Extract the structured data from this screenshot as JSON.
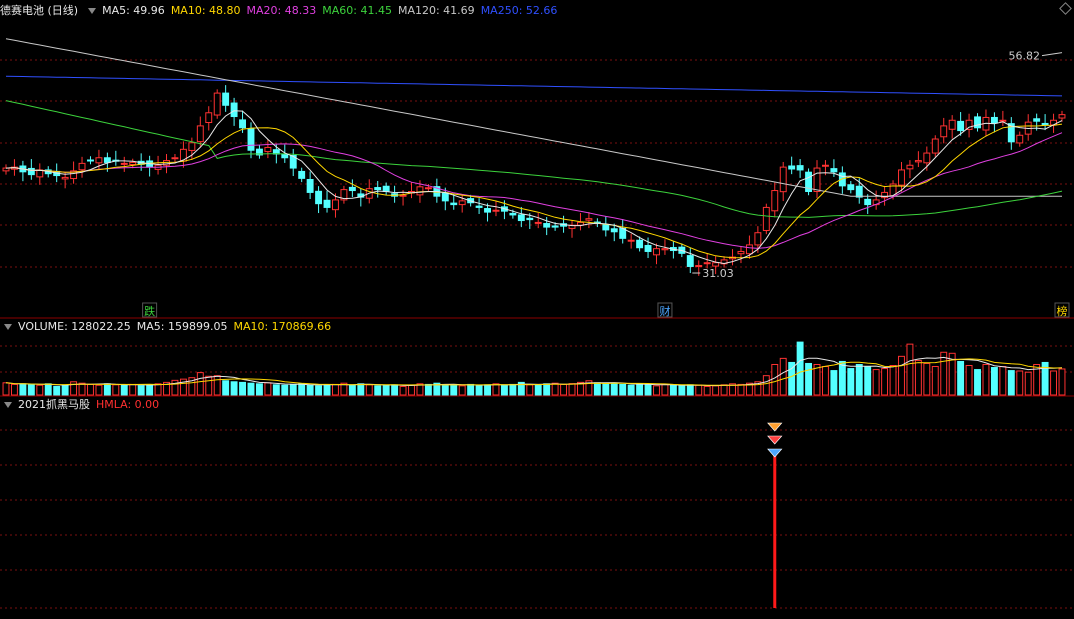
{
  "main": {
    "title": "德赛电池 (日线)",
    "ma_labels": [
      {
        "text": "MA5: 49.96",
        "color": "#e8e8e8"
      },
      {
        "text": "MA10: 48.80",
        "color": "#ffd700"
      },
      {
        "text": "MA20: 48.33",
        "color": "#e040e0"
      },
      {
        "text": "MA60: 41.45",
        "color": "#3cd23c"
      },
      {
        "text": "MA120: 41.69",
        "color": "#c8c8c8"
      },
      {
        "text": "MA250: 52.66",
        "color": "#3050ff"
      }
    ],
    "high_label": "56.82",
    "low_label": "31.03",
    "markers": [
      {
        "text": "跌",
        "color": "#3cd23c"
      },
      {
        "text": "财",
        "color": "#4da6ff"
      },
      {
        "text": "榜",
        "color": "#ffd700"
      }
    ]
  },
  "volume": {
    "labels": [
      {
        "text": "VOLUME: 128022.25",
        "color": "#e8e8e8"
      },
      {
        "text": "MA5: 159899.05",
        "color": "#e8e8e8"
      },
      {
        "text": "MA10: 170869.66",
        "color": "#ffd700"
      }
    ]
  },
  "indicator": {
    "labels": [
      {
        "text": "2021抓黑马股",
        "color": "#e8e8e8"
      },
      {
        "text": "HMLA: 0.00",
        "color": "#ff3030"
      }
    ]
  },
  "colors": {
    "up": "#ff3232",
    "down": "#54ffff",
    "grid": "#7a1010",
    "separator": "#8b0000"
  },
  "chart_data": {
    "type": "candlestick",
    "price_range": [
      28.8,
      60.6
    ],
    "ohlc_close": [
      44.8,
      44.9,
      44.4,
      44.1,
      44.6,
      44.2,
      44.0,
      43.8,
      44.5,
      45.3,
      45.6,
      45.9,
      45.4,
      45.6,
      45.3,
      45.4,
      45.2,
      44.9,
      45.1,
      45.6,
      45.9,
      46.8,
      47.5,
      49.3,
      50.7,
      52.8,
      51.5,
      50.3,
      49.1,
      46.7,
      46.2,
      47.0,
      46.3,
      45.9,
      44.8,
      43.7,
      42.2,
      41.0,
      40.6,
      41.4,
      42.5,
      42.4,
      41.7,
      42.6,
      42.5,
      42.3,
      41.8,
      41.9,
      42.3,
      42.8,
      42.7,
      41.8,
      41.3,
      40.9,
      41.3,
      41.1,
      40.6,
      40.1,
      40.3,
      40.2,
      39.8,
      39.2,
      39.3,
      39.0,
      38.5,
      38.5,
      38.6,
      38.7,
      39.0,
      39.4,
      38.9,
      38.2,
      38.0,
      37.3,
      37.1,
      36.3,
      35.9,
      36.2,
      36.2,
      36.0,
      35.7,
      34.3,
      34.4,
      34.7,
      34.7,
      35.0,
      35.3,
      35.9,
      36.6,
      37.9,
      40.6,
      42.4,
      44.9,
      44.7,
      44.6,
      42.3,
      44.8,
      45.1,
      44.4,
      42.9,
      42.5,
      41.7,
      40.9,
      41.4,
      42.2,
      43.1,
      44.6,
      45.1,
      45.6,
      46.4,
      47.9,
      49.3,
      49.9,
      48.8,
      49.9,
      49.1,
      50.2,
      49.6,
      49.9,
      47.6,
      48.3,
      49.7,
      49.8,
      49.4,
      49.9,
      50.5
    ],
    "ma_series": [
      {
        "name": "MA5",
        "last": 49.96
      },
      {
        "name": "MA10",
        "last": 48.8
      },
      {
        "name": "MA20",
        "last": 48.33
      },
      {
        "name": "MA60",
        "last": 41.45
      },
      {
        "name": "MA120",
        "last": 41.69
      },
      {
        "name": "MA250",
        "last": 52.66
      }
    ],
    "volume_range": [
      0,
      420000
    ],
    "volume": [
      60,
      52,
      55,
      50,
      48,
      55,
      42,
      48,
      65,
      58,
      52,
      48,
      55,
      50,
      48,
      52,
      46,
      50,
      55,
      62,
      72,
      78,
      85,
      110,
      92,
      95,
      70,
      65,
      62,
      58,
      55,
      60,
      50,
      48,
      52,
      55,
      48,
      45,
      50,
      52,
      58,
      48,
      55,
      50,
      45,
      48,
      50,
      42,
      48,
      55,
      52,
      58,
      48,
      50,
      45,
      52,
      48,
      50,
      55,
      48,
      52,
      62,
      50,
      48,
      55,
      58,
      52,
      56,
      62,
      70,
      60,
      55,
      58,
      52,
      48,
      55,
      50,
      45,
      52,
      48,
      45,
      50,
      48,
      42,
      45,
      50,
      55,
      52,
      58,
      65,
      95,
      150,
      180,
      160,
      260,
      155,
      150,
      140,
      120,
      165,
      130,
      150,
      140,
      125,
      130,
      145,
      190,
      250,
      170,
      155,
      140,
      210,
      205,
      165,
      145,
      125,
      150,
      135,
      140,
      120,
      118,
      112,
      150,
      160,
      118,
      128
    ],
    "hmla_signal_index": 91
  }
}
